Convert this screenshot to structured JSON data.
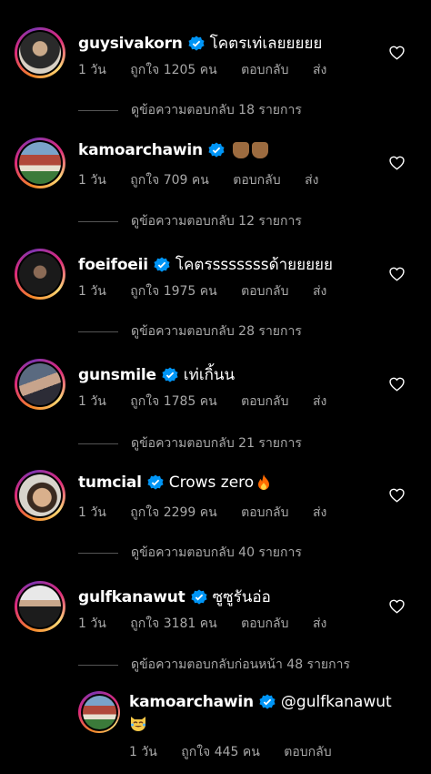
{
  "comments": [
    {
      "username": "guysivakorn",
      "text": "โคตรเท่เลยยยยย",
      "time": "1 วัน",
      "likes": "ถูกใจ 1205 คน",
      "reply": "ตอบกลับ",
      "send": "ส่ง",
      "view_replies": "ดูข้อความตอบกลับ 18 รายการ"
    },
    {
      "username": "kamoarchawin",
      "text": "",
      "emoji": "thumbs-up-medium-dark x2",
      "time": "1 วัน",
      "likes": "ถูกใจ 709 คน",
      "reply": "ตอบกลับ",
      "send": "ส่ง",
      "view_replies": "ดูข้อความตอบกลับ 12 รายการ"
    },
    {
      "username": "foeifoeii",
      "text": "โคตรsssssssด้ายยยยย",
      "time": "1 วัน",
      "likes": "ถูกใจ 1975 คน",
      "reply": "ตอบกลับ",
      "send": "ส่ง",
      "view_replies": "ดูข้อความตอบกลับ 28 รายการ"
    },
    {
      "username": "gunsmile",
      "text": "เท่เกิ้นน",
      "time": "1 วัน",
      "likes": "ถูกใจ 1785 คน",
      "reply": "ตอบกลับ",
      "send": "ส่ง",
      "view_replies": "ดูข้อความตอบกลับ 21 รายการ"
    },
    {
      "username": "tumcial",
      "text": "Crows zero",
      "emoji": "fire",
      "time": "1 วัน",
      "likes": "ถูกใจ 2299 คน",
      "reply": "ตอบกลับ",
      "send": "ส่ง",
      "view_replies": "ดูข้อความตอบกลับ 40 รายการ"
    },
    {
      "username": "gulfkanawut",
      "text": "ซูซูรันอ่อ",
      "time": "1 วัน",
      "likes": "ถูกใจ 3181 คน",
      "reply": "ตอบกลับ",
      "send": "ส่ง",
      "view_replies": "ดูข้อความตอบกลับก่อนหน้า 48 รายการ"
    }
  ],
  "reply_comment": {
    "username": "kamoarchawin",
    "mention": "@gulfkanawut",
    "emoji": "cat-joy",
    "time": "1 วัน",
    "likes": "ถูกใจ 445 คน",
    "reply": "ตอบกลับ"
  },
  "colors": {
    "background": "#000000",
    "secondary_text": "#a8a8a8",
    "verified": "#0095f6"
  }
}
